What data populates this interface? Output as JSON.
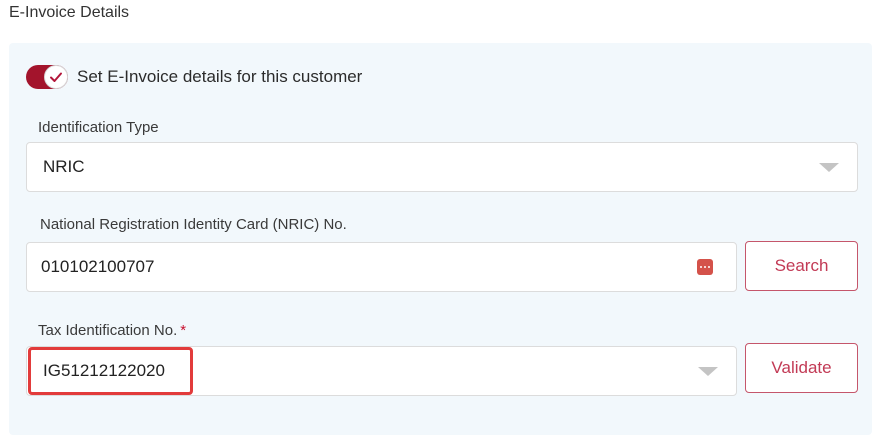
{
  "section": {
    "title": "E-Invoice Details"
  },
  "toggle": {
    "label": "Set E-Invoice details for this customer",
    "checked": true,
    "accent": "#a3142c"
  },
  "identification_type": {
    "label": "Identification Type",
    "value": "NRIC"
  },
  "nric": {
    "label": "National Registration Identity Card (NRIC) No.",
    "value": "010102100707",
    "search_label": "Search"
  },
  "tin": {
    "label": "Tax Identification No.",
    "required_mark": "*",
    "value": "IG51212122020",
    "validate_label": "Validate"
  },
  "colors": {
    "button_text": "#c23a55",
    "highlight": "#e23b3b",
    "panel_bg": "#f2f8fc"
  }
}
